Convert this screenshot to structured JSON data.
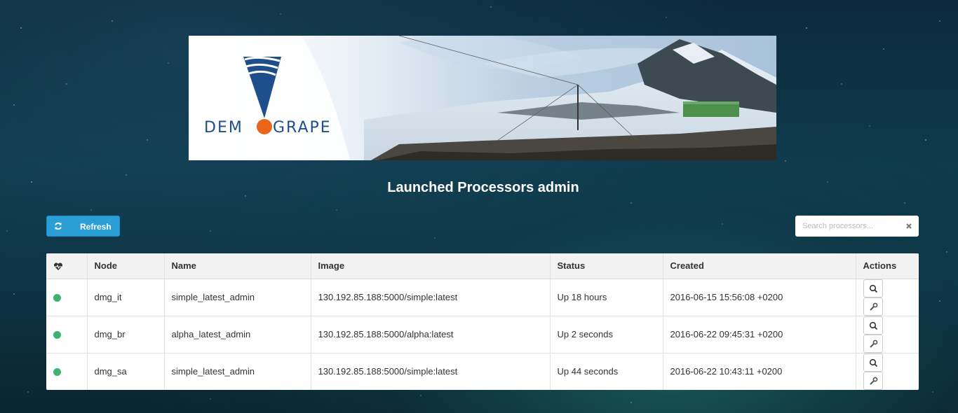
{
  "header": {
    "logo_text": "DEMOGRAPE",
    "title": "Launched Processors admin"
  },
  "toolbar": {
    "refresh_label": "Refresh",
    "refresh_icon": "refresh-icon"
  },
  "search": {
    "placeholder": "Search processors...",
    "value": "",
    "clear_icon": "close-icon"
  },
  "table": {
    "columns": {
      "health_icon": "heartbeat-icon",
      "node": "Node",
      "name": "Name",
      "image": "Image",
      "status": "Status",
      "created": "Created",
      "actions": "Actions"
    },
    "rows": [
      {
        "health": "running",
        "node": "dmg_it",
        "name": "simple_latest_admin",
        "image": "130.192.85.188:5000/simple:latest",
        "status": "Up 18 hours",
        "created": "2016-06-15 15:56:08 +0200"
      },
      {
        "health": "running",
        "node": "dmg_br",
        "name": "alpha_latest_admin",
        "image": "130.192.85.188:5000/alpha:latest",
        "status": "Up 2 seconds",
        "created": "2016-06-22 09:45:31 +0200"
      },
      {
        "health": "running",
        "node": "dmg_sa",
        "name": "simple_latest_admin",
        "image": "130.192.85.188:5000/simple:latest",
        "status": "Up 44 seconds",
        "created": "2016-06-22 10:43:11 +0200"
      }
    ],
    "row_actions": [
      "search-icon",
      "wrench-icon"
    ]
  },
  "colors": {
    "primary": "#2a9fd6",
    "status_ok": "#3cb371",
    "logo_blue": "#1f4e8c",
    "logo_orange": "#e8651a"
  }
}
